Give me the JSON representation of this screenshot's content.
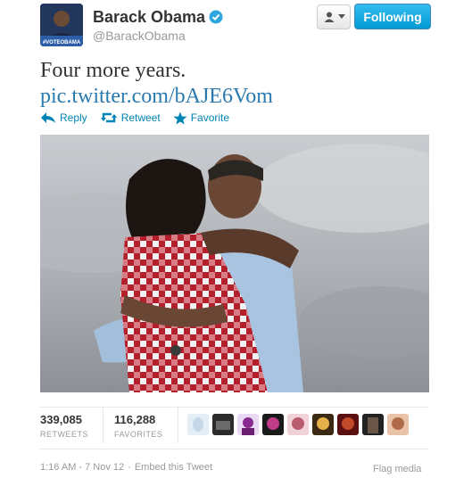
{
  "header": {
    "avatar_text": "#VOTEOBAMA",
    "name": "Barack Obama",
    "handle": "@BarackObama",
    "follow_label": "Following"
  },
  "tweet": {
    "text": "Four more years.",
    "link": "pic.twitter.com/bAJE6Vom"
  },
  "actions": [
    {
      "label": "Reply",
      "icon": "reply-icon"
    },
    {
      "label": "Retweet",
      "icon": "retweet-icon"
    },
    {
      "label": "Favorite",
      "icon": "star-icon"
    }
  ],
  "stats": {
    "retweets_count": "339,085",
    "retweets_label": "RETWEETS",
    "favorites_count": "116,288",
    "favorites_label": "FAVORITES"
  },
  "footer": {
    "timestamp": "1:16 AM - 7 Nov 12",
    "separator": "·",
    "embed_label": "Embed this Tweet",
    "flag_label": "Flag media"
  },
  "colors": {
    "accent": "#0084b4",
    "follow_button": "#019ad2"
  }
}
